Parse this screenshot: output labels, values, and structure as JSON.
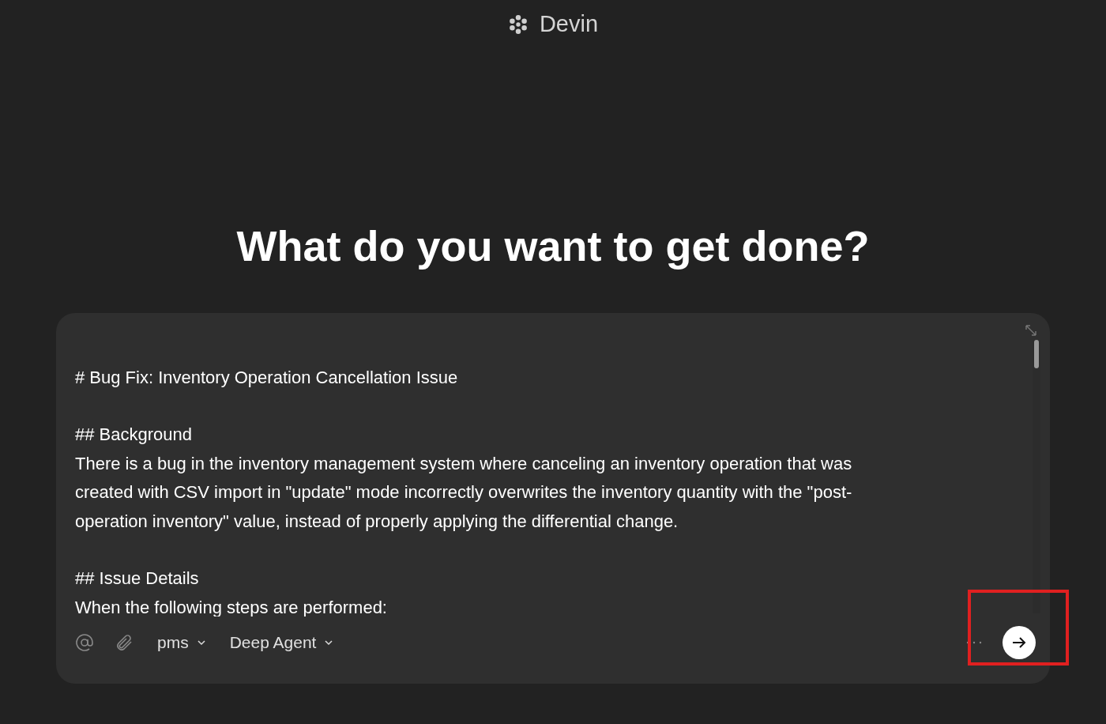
{
  "brand": {
    "name": "Devin"
  },
  "heading": "What do you want to get done?",
  "prompt": {
    "blocks": [
      {
        "lines": [
          "# Bug Fix: Inventory Operation Cancellation Issue"
        ]
      },
      {
        "lines": [
          "## Background",
          "There is a bug in the inventory management system where canceling an inventory operation that was",
          "created with CSV import in \"update\" mode incorrectly overwrites the inventory quantity with the \"post-",
          "operation inventory\" value, instead of properly applying the differential change."
        ]
      },
      {
        "lines": [
          "## Issue Details",
          "When the following steps are performed:"
        ]
      }
    ]
  },
  "toolbar": {
    "repo": "pms",
    "agent": "Deep Agent"
  },
  "highlight": {
    "shown": true
  }
}
